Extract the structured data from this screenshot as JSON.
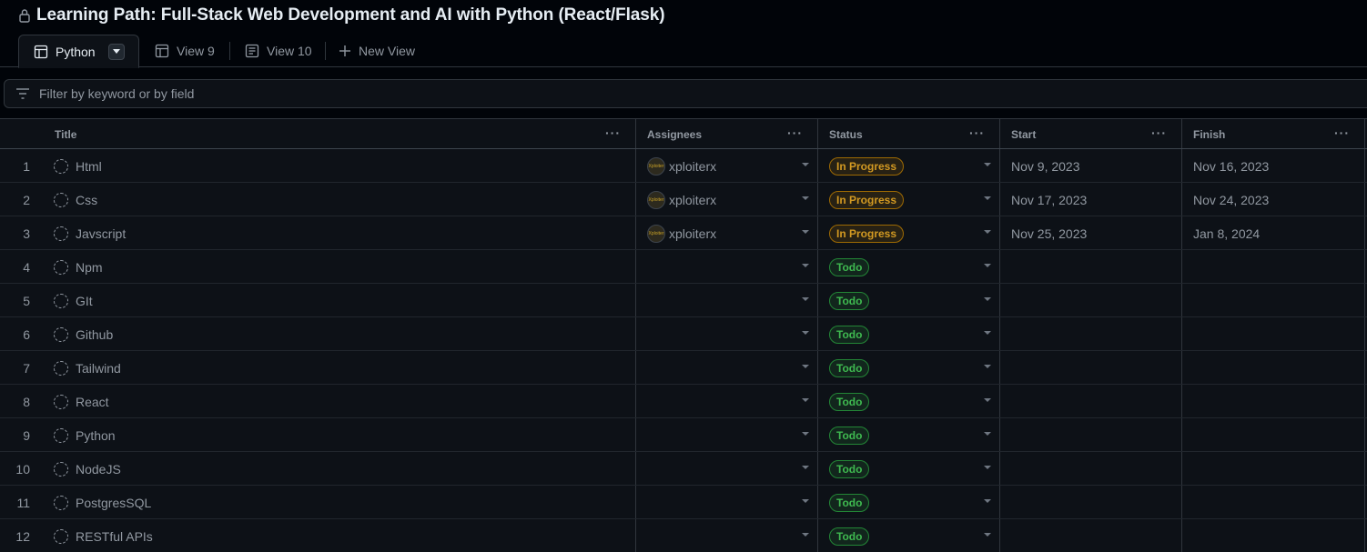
{
  "project": {
    "title": "Learning Path: Full-Stack Web Development and AI with Python (React/Flask)"
  },
  "tabs": [
    {
      "label": "Python",
      "icon": "table-icon",
      "active": true
    },
    {
      "label": "View 9",
      "icon": "table-icon"
    },
    {
      "label": "View 10",
      "icon": "board-icon"
    },
    {
      "label": "New View",
      "icon": "plus-icon"
    }
  ],
  "filter": {
    "placeholder": "Filter by keyword or by field"
  },
  "columns": [
    "Title",
    "Assignees",
    "Status",
    "Start",
    "Finish"
  ],
  "colors": {
    "in_progress": "#d29922",
    "todo": "#3fb950",
    "background": "#0d1117"
  },
  "rows": [
    {
      "num": "1",
      "title": "Html",
      "assignee": "xploiterx",
      "avatar_text": "Xploiter",
      "status": "In Progress",
      "start": "Nov 9, 2023",
      "finish": "Nov 16, 2023"
    },
    {
      "num": "2",
      "title": "Css",
      "assignee": "xploiterx",
      "avatar_text": "Xploiter",
      "status": "In Progress",
      "start": "Nov 17, 2023",
      "finish": "Nov 24, 2023"
    },
    {
      "num": "3",
      "title": "Javscript",
      "assignee": "xploiterx",
      "avatar_text": "Xploiter",
      "status": "In Progress",
      "start": "Nov 25, 2023",
      "finish": "Jan 8, 2024"
    },
    {
      "num": "4",
      "title": "Npm",
      "assignee": "",
      "status": "Todo",
      "start": "",
      "finish": ""
    },
    {
      "num": "5",
      "title": "GIt",
      "assignee": "",
      "status": "Todo",
      "start": "",
      "finish": ""
    },
    {
      "num": "6",
      "title": "Github",
      "assignee": "",
      "status": "Todo",
      "start": "",
      "finish": ""
    },
    {
      "num": "7",
      "title": "Tailwind",
      "assignee": "",
      "status": "Todo",
      "start": "",
      "finish": ""
    },
    {
      "num": "8",
      "title": "React",
      "assignee": "",
      "status": "Todo",
      "start": "",
      "finish": ""
    },
    {
      "num": "9",
      "title": "Python",
      "assignee": "",
      "status": "Todo",
      "start": "",
      "finish": ""
    },
    {
      "num": "10",
      "title": "NodeJS",
      "assignee": "",
      "status": "Todo",
      "start": "",
      "finish": ""
    },
    {
      "num": "11",
      "title": "PostgresSQL",
      "assignee": "",
      "status": "Todo",
      "start": "",
      "finish": ""
    },
    {
      "num": "12",
      "title": "RESTful APIs",
      "assignee": "",
      "status": "Todo",
      "start": "",
      "finish": ""
    }
  ]
}
